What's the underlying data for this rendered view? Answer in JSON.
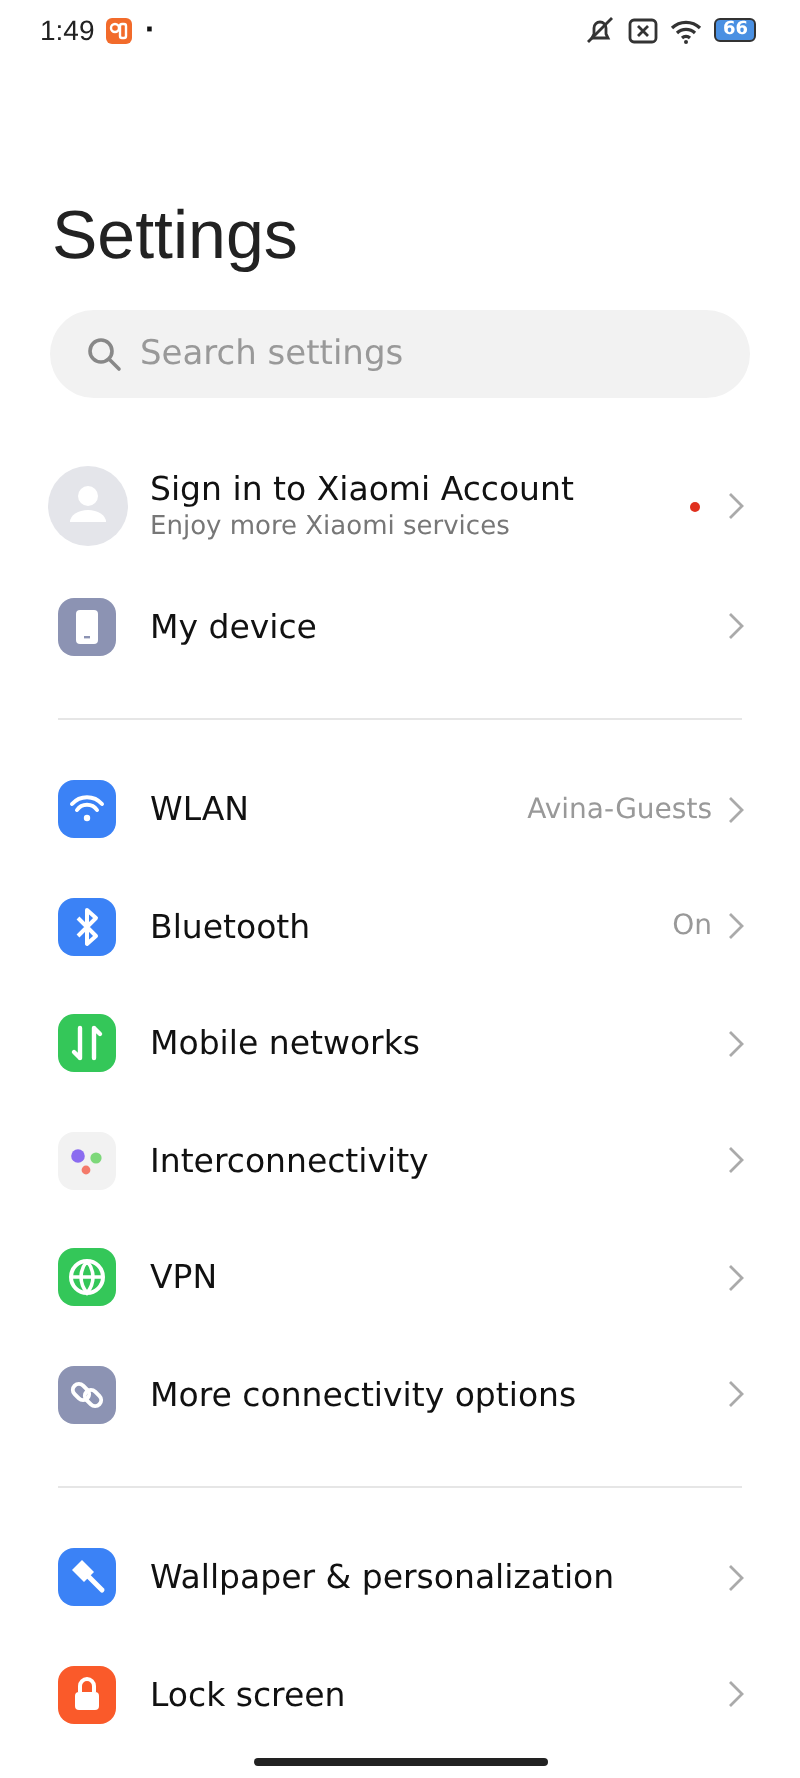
{
  "status_bar": {
    "time": "1:49",
    "dot": "·",
    "battery": "66"
  },
  "title": "Settings",
  "search": {
    "placeholder": "Search settings"
  },
  "account": {
    "title": "Sign in to Xiaomi Account",
    "subtitle": "Enjoy more Xiaomi services",
    "notification": true
  },
  "groups": [
    [
      {
        "kind": "device",
        "color": "#8c93b3",
        "label": "My device"
      }
    ],
    [
      {
        "kind": "wifi",
        "color": "#3b82f6",
        "label": "WLAN",
        "value": "Avina-Guests"
      },
      {
        "kind": "bluetooth",
        "color": "#3b82f6",
        "label": "Bluetooth",
        "value": "On"
      },
      {
        "kind": "mobile",
        "color": "#34c759",
        "label": "Mobile networks"
      },
      {
        "kind": "interconnect",
        "color": "#f2f2f2",
        "label": "Interconnectivity"
      },
      {
        "kind": "vpn",
        "color": "#34c759",
        "label": "VPN"
      },
      {
        "kind": "link",
        "color": "#8c93b3",
        "label": "More connectivity options"
      }
    ],
    [
      {
        "kind": "brush",
        "color": "#3b82f6",
        "label": "Wallpaper & personalization"
      },
      {
        "kind": "lock",
        "color": "#fa5a2a",
        "label": "Lock screen"
      }
    ]
  ]
}
